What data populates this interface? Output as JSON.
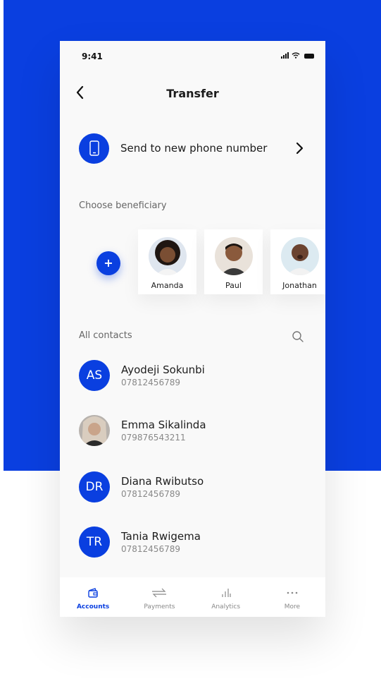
{
  "status": {
    "time": "9:41"
  },
  "header": {
    "title": "Transfer"
  },
  "send_new": {
    "label": "Send to new phone number"
  },
  "beneficiaries": {
    "heading": "Choose beneficiary",
    "items": [
      {
        "name": "Amanda"
      },
      {
        "name": "Paul"
      },
      {
        "name": "Jonathan"
      }
    ]
  },
  "contacts": {
    "heading": "All contacts",
    "items": [
      {
        "initials": "AS",
        "name": "Ayodeji Sokunbi",
        "phone": "07812456789"
      },
      {
        "initials": "",
        "name": "Emma Sikalinda",
        "phone": "079876543211"
      },
      {
        "initials": "DR",
        "name": "Diana Rwibutso",
        "phone": "07812456789"
      },
      {
        "initials": "TR",
        "name": "Tania Rwigema",
        "phone": "07812456789"
      }
    ]
  },
  "tabbar": {
    "items": [
      {
        "label": "Accounts",
        "icon": "wallet-icon"
      },
      {
        "label": "Payments",
        "icon": "transfer-arrows-icon"
      },
      {
        "label": "Analytics",
        "icon": "bar-chart-icon"
      },
      {
        "label": "More",
        "icon": "more-dots-icon"
      }
    ]
  },
  "colors": {
    "accent": "#0a3fe0",
    "background": "#f9f9f9"
  }
}
